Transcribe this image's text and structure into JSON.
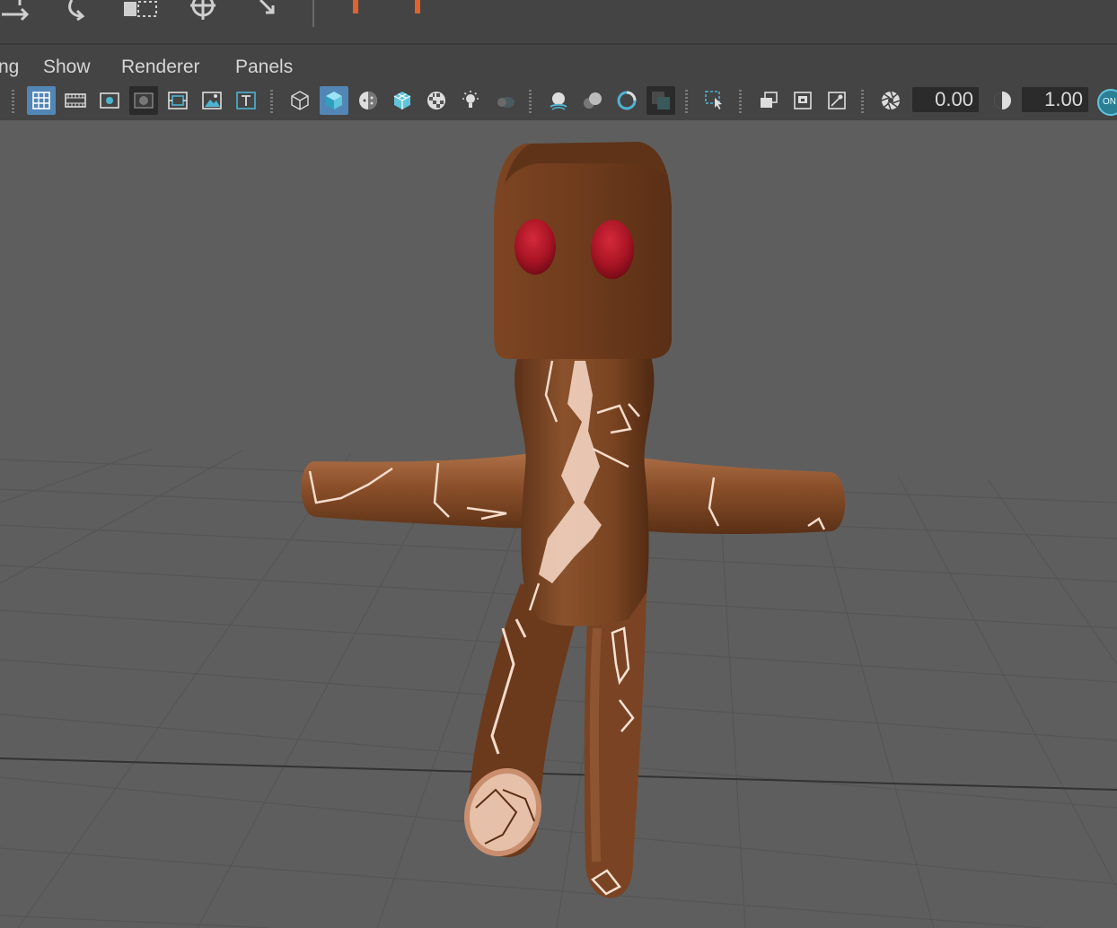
{
  "menu": {
    "items": [
      "ng",
      "Show",
      "Renderer",
      "Panels"
    ]
  },
  "panel_toolbar": {
    "buttons": [
      "grid-icon",
      "film-gate-icon",
      "resolution-gate-icon",
      "gate-mask-icon",
      "field-chart-icon",
      "image-plane-icon",
      "text-overlay-icon",
      "wireframe-cube-icon",
      "smooth-shade-cube-icon",
      "default-material-icon",
      "wireframe-on-shaded-icon",
      "textured-icon",
      "use-lights-icon",
      "shadows-icon",
      "screen-space-ao-icon",
      "motion-blur-icon",
      "anti-alias-icon",
      "depth-of-field-icon",
      "select-camera-icon",
      "isolate-select-icon",
      "xray-icon",
      "xray-joints-icon",
      "exposure-icon",
      "gamma-icon",
      "color-management-toggle"
    ],
    "exposure_value": "0.00",
    "gamma_value": "1.00",
    "color_management_label": "ON"
  },
  "colors": {
    "ui_background": "#444444",
    "viewport_background": "#5e5e5e",
    "active_button": "#5286b6",
    "keyframe_tick": "#e0622c",
    "character_body": "#7a4522",
    "character_eyes": "#b01828",
    "crack_highlight": "#f3d3c0"
  },
  "viewport": {
    "content": "3D character model with brown body, red eyes and glowing cracks standing on a perspective grid"
  }
}
